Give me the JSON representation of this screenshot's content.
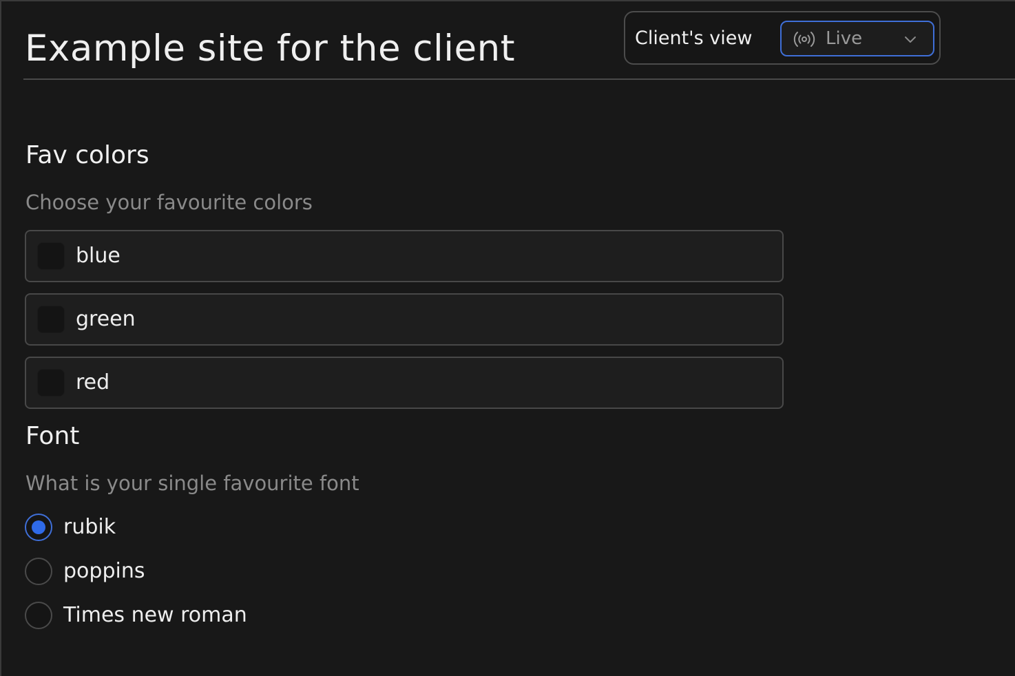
{
  "page": {
    "title": "Example site for the client"
  },
  "view_switcher": {
    "label": "Client's view",
    "selected": "Live",
    "icon": "broadcast-icon",
    "accent_color": "#3f6fd8"
  },
  "colors_section": {
    "title": "Fav colors",
    "description": "Choose your favourite colors",
    "options": [
      {
        "label": "blue",
        "checked": false
      },
      {
        "label": "green",
        "checked": false
      },
      {
        "label": "red",
        "checked": false
      }
    ]
  },
  "font_section": {
    "title": "Font",
    "description": "What is your single favourite font",
    "options": [
      {
        "label": "rubik",
        "selected": true
      },
      {
        "label": "poppins",
        "selected": false
      },
      {
        "label": "Times new roman",
        "selected": false
      }
    ]
  }
}
